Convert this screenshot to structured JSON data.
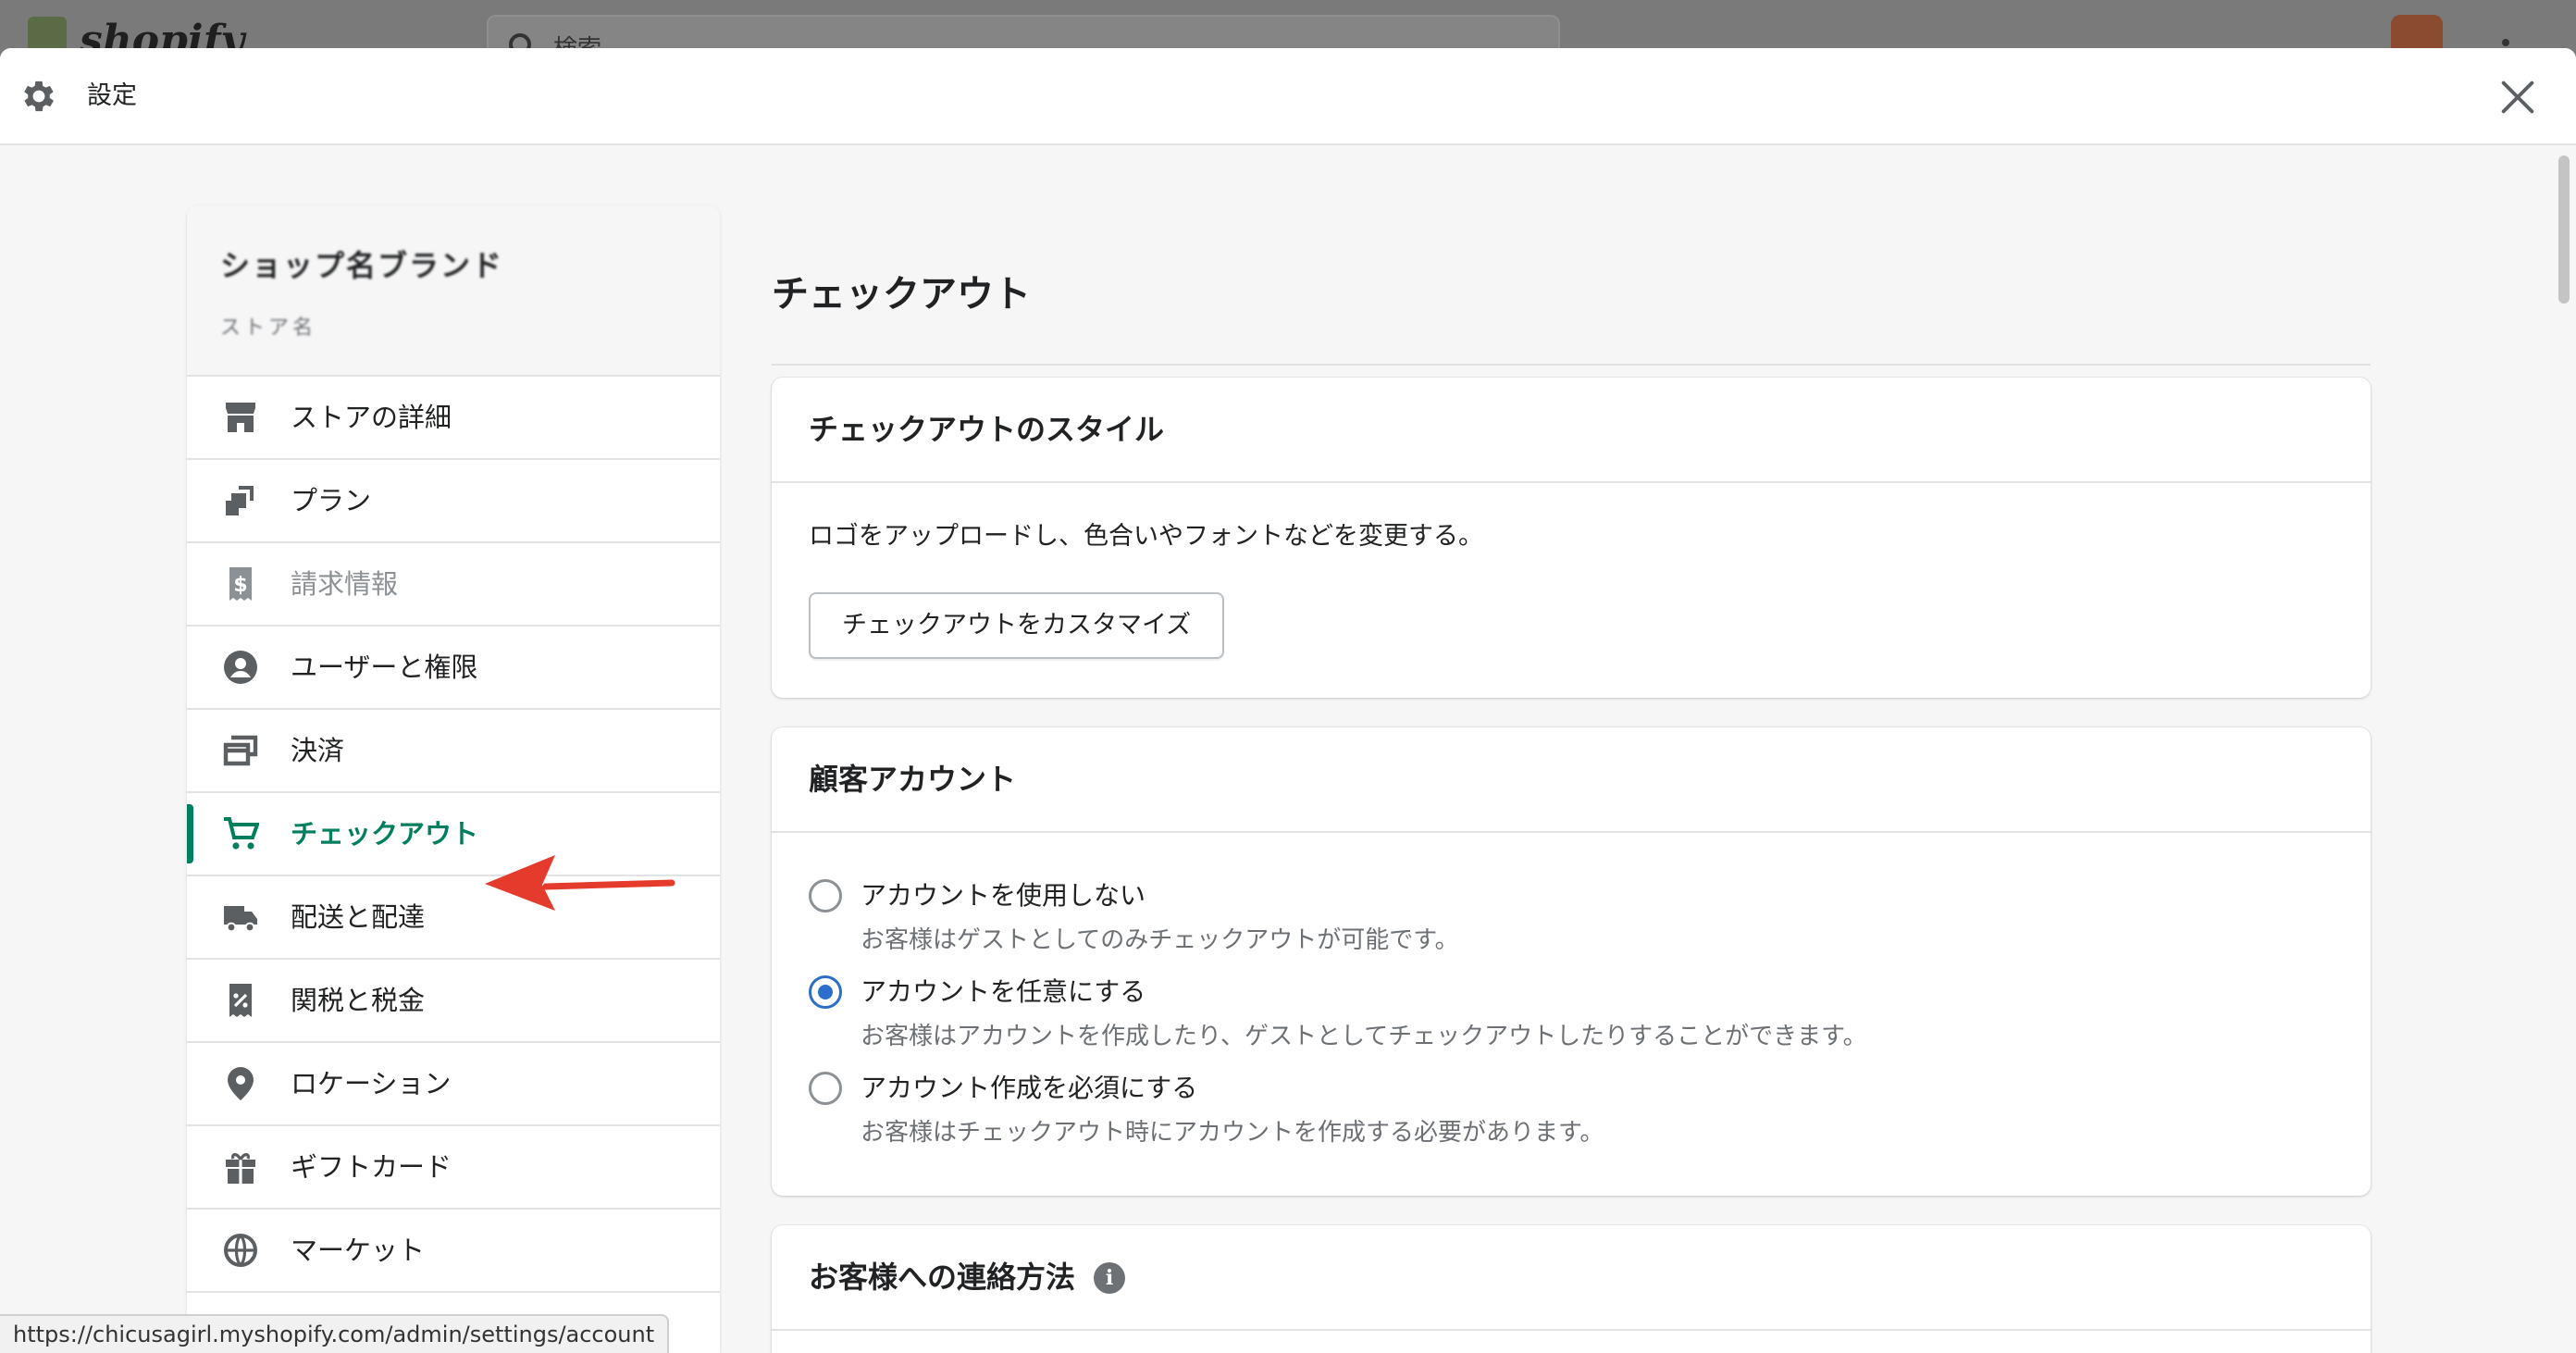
{
  "background": {
    "brand": "shopify",
    "search_placeholder": "検索"
  },
  "modal": {
    "title": "設定",
    "icons": {
      "settings": "gear-icon",
      "close": "close-icon"
    }
  },
  "sidebar": {
    "store_name": "ショップ名ブランド",
    "store_sub": "ストア名",
    "items": [
      {
        "label": "ストアの詳細",
        "icon": "store-icon",
        "state": "default"
      },
      {
        "label": "プラン",
        "icon": "plan-icon",
        "state": "default"
      },
      {
        "label": "請求情報",
        "icon": "billing-icon",
        "state": "disabled"
      },
      {
        "label": "ユーザーと権限",
        "icon": "user-icon",
        "state": "default"
      },
      {
        "label": "決済",
        "icon": "payment-icon",
        "state": "default"
      },
      {
        "label": "チェックアウト",
        "icon": "cart-icon",
        "state": "active"
      },
      {
        "label": "配送と配達",
        "icon": "truck-icon",
        "state": "default"
      },
      {
        "label": "関税と税金",
        "icon": "tax-icon",
        "state": "default"
      },
      {
        "label": "ロケーション",
        "icon": "location-icon",
        "state": "default"
      },
      {
        "label": "ギフトカード",
        "icon": "gift-icon",
        "state": "default"
      },
      {
        "label": "マーケット",
        "icon": "globe-icon",
        "state": "default"
      }
    ]
  },
  "main": {
    "page_title": "チェックアウト",
    "style_card": {
      "title": "チェックアウトのスタイル",
      "description": "ロゴをアップロードし、色合いやフォントなどを変更する。",
      "button_label": "チェックアウトをカスタマイズ"
    },
    "accounts_card": {
      "title": "顧客アカウント",
      "options": [
        {
          "label": "アカウントを使用しない",
          "help": "お客様はゲストとしてのみチェックアウトが可能です。",
          "checked": false
        },
        {
          "label": "アカウントを任意にする",
          "help": "お客様はアカウントを作成したり、ゲストとしてチェックアウトしたりすることができます。",
          "checked": true
        },
        {
          "label": "アカウント作成を必須にする",
          "help": "お客様はチェックアウト時にアカウントを作成する必要があります。",
          "checked": false
        }
      ]
    },
    "contact_card": {
      "title": "お客様への連絡方法",
      "info_icon": "info-icon",
      "info_glyph": "i"
    }
  },
  "status_bar": {
    "url": "https://chicusagirl.myshopify.com/admin/settings/account"
  },
  "colors": {
    "accent_green": "#008060",
    "active_text": "#007f5f",
    "radio_blue": "#2c6ecb",
    "annotation_red": "#e53b2c"
  }
}
